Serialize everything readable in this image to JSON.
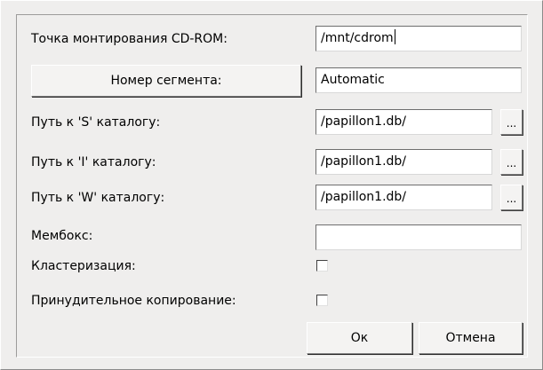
{
  "dialog": {
    "mount_label": "Точка монтирования CD-ROM:",
    "mount_value": "/mnt/cdrom",
    "segment_button": "Номер сегмента:",
    "segment_value": "Automatic",
    "s_path_label": "Путь к 'S' каталогу:",
    "s_path_value": "/papillon1.db/",
    "i_path_label": "Путь к 'I' каталогу:",
    "i_path_value": "/papillon1.db/",
    "w_path_label": "Путь к 'W' каталогу:",
    "w_path_value": "/papillon1.db/",
    "browse_label": "...",
    "membox_label": "Мембокс:",
    "membox_value": "",
    "clustering_label": "Кластеризация:",
    "clustering_checked": false,
    "force_copy_label": "Принудительное копирование:",
    "force_copy_checked": false,
    "ok_button": "Ок",
    "cancel_button": "Отмена"
  }
}
